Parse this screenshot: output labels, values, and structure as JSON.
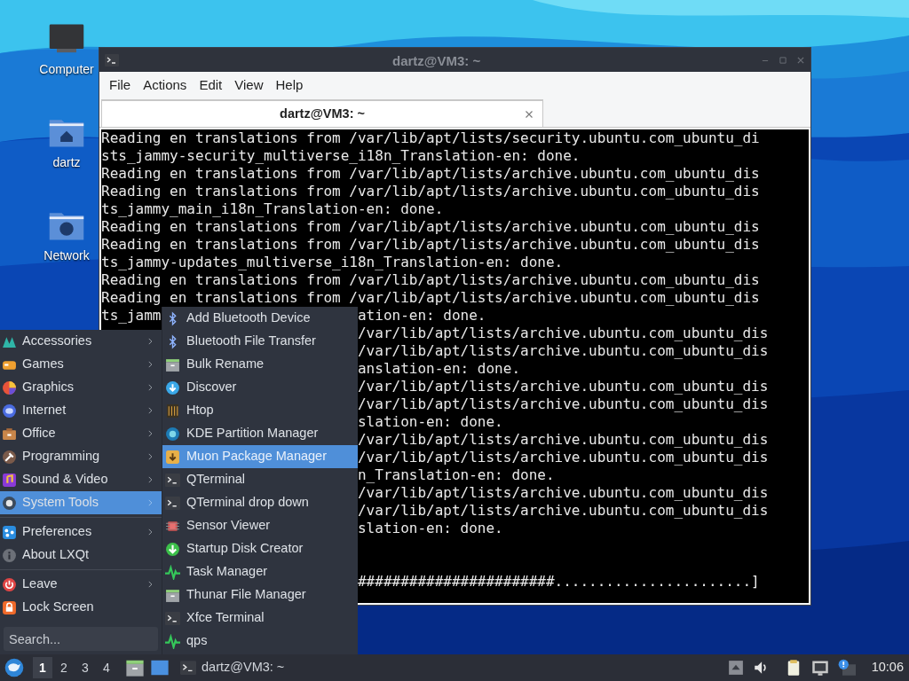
{
  "desktop_icons": [
    {
      "label": "Computer",
      "kind": "computer"
    },
    {
      "label": "dartz",
      "kind": "home"
    },
    {
      "label": "Network",
      "kind": "network"
    }
  ],
  "terminal_window": {
    "title": "dartz@VM3: ~",
    "menu": [
      "File",
      "Actions",
      "Edit",
      "View",
      "Help"
    ],
    "tabs": [
      {
        "label": "dartz@VM3: ~",
        "selected": true
      }
    ],
    "lines": [
      {
        "kind": "full",
        "text": "Reading en translations from /var/lib/apt/lists/security.ubuntu.com_ubuntu_di"
      },
      {
        "kind": "full",
        "text": "sts_jammy-security_multiverse_i18n_Translation-en: done."
      },
      {
        "kind": "full",
        "text": "Reading en translations from /var/lib/apt/lists/archive.ubuntu.com_ubuntu_dis"
      },
      {
        "kind": "full",
        "text": "Reading en translations from /var/lib/apt/lists/archive.ubuntu.com_ubuntu_dis"
      },
      {
        "kind": "full",
        "text": "ts_jammy_main_i18n_Translation-en: done."
      },
      {
        "kind": "full",
        "text": "Reading en translations from /var/lib/apt/lists/archive.ubuntu.com_ubuntu_dis"
      },
      {
        "kind": "full",
        "text": "Reading en translations from /var/lib/apt/lists/archive.ubuntu.com_ubuntu_dis"
      },
      {
        "kind": "full",
        "text": "ts_jammy-updates_multiverse_i18n_Translation-en: done."
      },
      {
        "kind": "full",
        "text": "Reading en translations from /var/lib/apt/lists/archive.ubuntu.com_ubuntu_dis"
      },
      {
        "kind": "full",
        "text": "Reading en translations from /var/lib/apt/lists/archive.ubuntu.com_ubuntu_dis"
      },
      {
        "kind": "split",
        "left": "ts_jamm",
        "right": "ation-en: done."
      },
      {
        "kind": "split",
        "right": "/var/lib/apt/lists/archive.ubuntu.com_ubuntu_dis"
      },
      {
        "kind": "split",
        "right": "/var/lib/apt/lists/archive.ubuntu.com_ubuntu_dis"
      },
      {
        "kind": "split",
        "right": "anslation-en: done."
      },
      {
        "kind": "split",
        "right": "/var/lib/apt/lists/archive.ubuntu.com_ubuntu_dis"
      },
      {
        "kind": "split",
        "right": "/var/lib/apt/lists/archive.ubuntu.com_ubuntu_dis"
      },
      {
        "kind": "split",
        "right": "slation-en: done."
      },
      {
        "kind": "split",
        "right": "/var/lib/apt/lists/archive.ubuntu.com_ubuntu_dis"
      },
      {
        "kind": "split",
        "right": "/var/lib/apt/lists/archive.ubuntu.com_ubuntu_dis"
      },
      {
        "kind": "split",
        "right": "n_Translation-en: done."
      },
      {
        "kind": "split",
        "right": "/var/lib/apt/lists/archive.ubuntu.com_ubuntu_dis"
      },
      {
        "kind": "split",
        "right": "/var/lib/apt/lists/archive.ubuntu.com_ubuntu_dis"
      },
      {
        "kind": "split",
        "right": "slation-en: done."
      },
      {
        "kind": "blank"
      },
      {
        "kind": "blank"
      },
      {
        "kind": "split",
        "right": "#######################.......................]"
      }
    ]
  },
  "app_menu": {
    "sections": [
      {
        "items": [
          {
            "label": "Accessories",
            "has_submenu": true,
            "selected": false
          },
          {
            "label": "Games",
            "has_submenu": true,
            "selected": false
          },
          {
            "label": "Graphics",
            "has_submenu": true,
            "selected": false
          },
          {
            "label": "Internet",
            "has_submenu": true,
            "selected": false
          },
          {
            "label": "Office",
            "has_submenu": true,
            "selected": false
          },
          {
            "label": "Programming",
            "has_submenu": true,
            "selected": false
          },
          {
            "label": "Sound & Video",
            "has_submenu": true,
            "selected": false
          },
          {
            "label": "System Tools",
            "has_submenu": true,
            "selected": true
          }
        ]
      },
      {
        "items": [
          {
            "label": "Preferences",
            "has_submenu": true,
            "selected": false
          },
          {
            "label": "About LXQt",
            "has_submenu": false,
            "selected": false
          }
        ]
      },
      {
        "items": [
          {
            "label": "Leave",
            "has_submenu": true,
            "selected": false
          },
          {
            "label": "Lock Screen",
            "has_submenu": false,
            "selected": false
          }
        ]
      }
    ],
    "search": {
      "placeholder": "Search..."
    },
    "submenu": [
      {
        "label": "Add Bluetooth Device",
        "selected": false
      },
      {
        "label": "Bluetooth File Transfer",
        "selected": false
      },
      {
        "label": "Bulk Rename",
        "selected": false
      },
      {
        "label": "Discover",
        "selected": false
      },
      {
        "label": "Htop",
        "selected": false
      },
      {
        "label": "KDE Partition Manager",
        "selected": false
      },
      {
        "label": "Muon Package Manager",
        "selected": true
      },
      {
        "label": "QTerminal",
        "selected": false
      },
      {
        "label": "QTerminal drop down",
        "selected": false
      },
      {
        "label": "Sensor Viewer",
        "selected": false
      },
      {
        "label": "Startup Disk Creator",
        "selected": false
      },
      {
        "label": "Task Manager",
        "selected": false
      },
      {
        "label": "Thunar File Manager",
        "selected": false
      },
      {
        "label": "Xfce Terminal",
        "selected": false
      },
      {
        "label": "qps",
        "selected": false
      }
    ]
  },
  "taskbar": {
    "workspaces": [
      {
        "label": "1",
        "selected": true
      },
      {
        "label": "2",
        "selected": false
      },
      {
        "label": "3",
        "selected": false
      },
      {
        "label": "4",
        "selected": false
      }
    ],
    "tasks": [
      {
        "label": "dartz@VM3: ~"
      }
    ],
    "clock": "10:06"
  }
}
